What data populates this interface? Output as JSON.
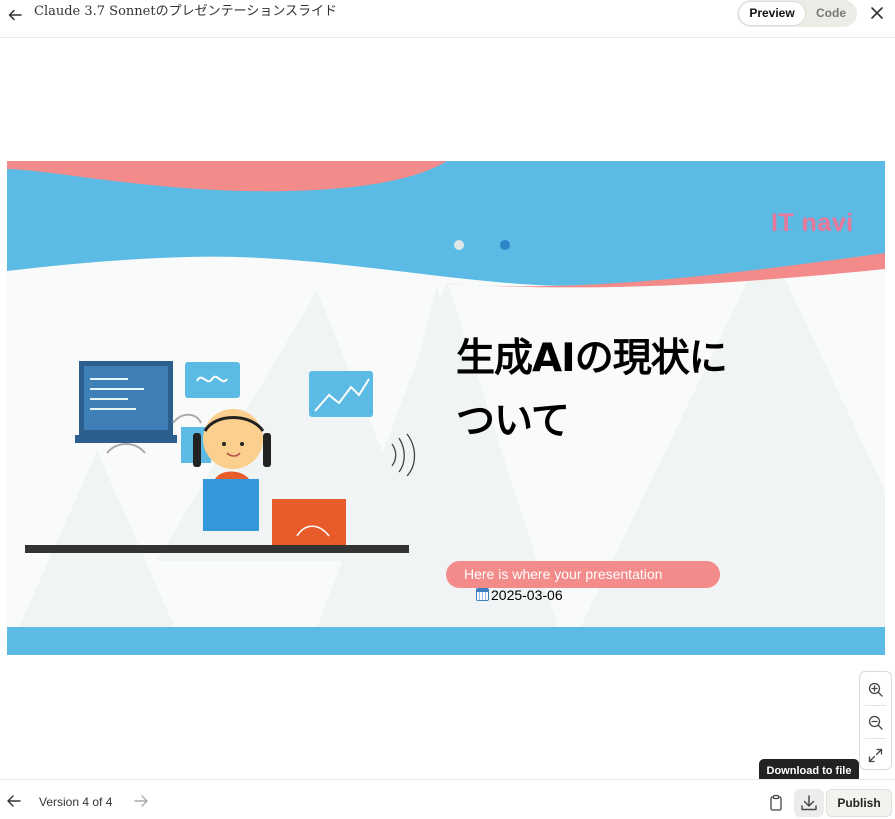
{
  "header": {
    "title": "Claude 3.7 Sonnetのプレゼンテーションスライド",
    "view_toggle": {
      "preview_label": "Preview",
      "code_label": "Code",
      "selected": "Preview"
    },
    "icons": {
      "back": "arrow-left-icon",
      "close": "close-icon"
    }
  },
  "slide": {
    "brand": "IT navi",
    "title_line1": "生成AIの現状に",
    "title_line2": "ついて",
    "subtitle": "Here is where your presentation",
    "date": "2025-03-06",
    "colors": {
      "sky_blue": "#5bbbe4",
      "coral": "#f48b8b",
      "brand_pink": "#e8789a",
      "dot_active": "#2f86c8"
    }
  },
  "zoom": {
    "icons": [
      "zoom-in-icon",
      "zoom-out-icon",
      "fullscreen-icon"
    ]
  },
  "tooltip": {
    "text": "Download to file"
  },
  "footer": {
    "version_label": "Version 4 of 4",
    "publish_label": "Publish",
    "icons": {
      "prev": "arrow-left-icon",
      "next": "arrow-right-icon",
      "copy": "clipboard-icon",
      "download": "download-icon"
    }
  }
}
